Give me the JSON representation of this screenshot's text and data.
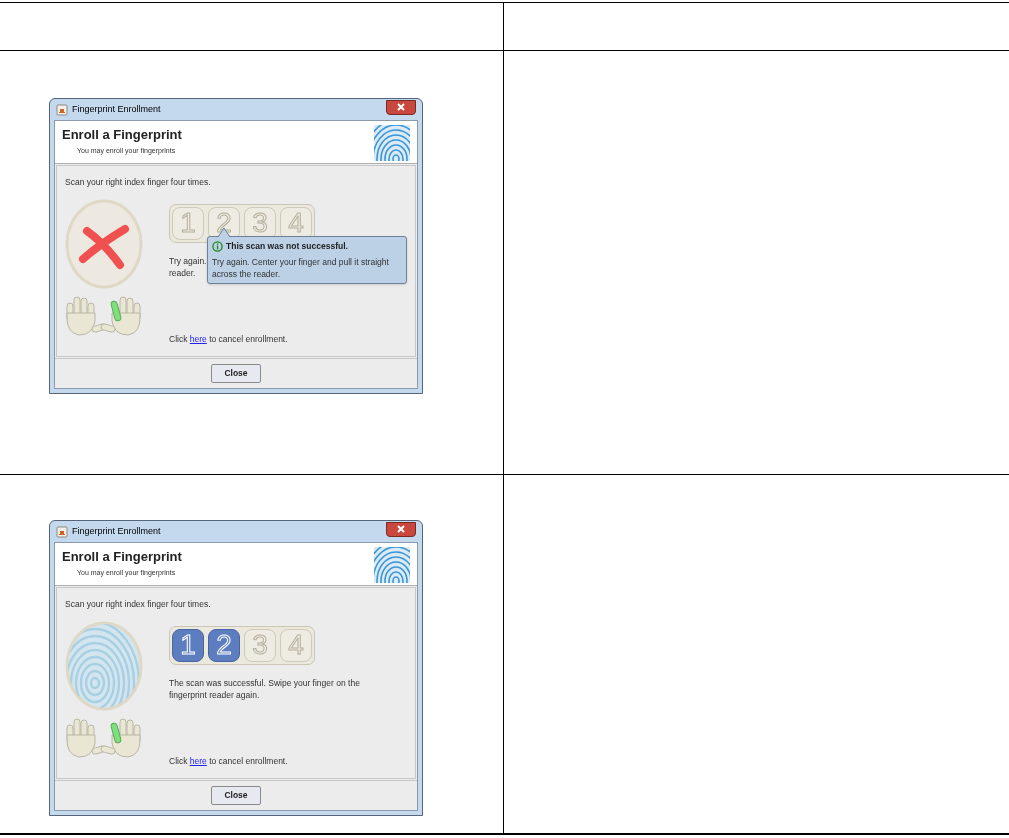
{
  "rows": [
    {
      "window": {
        "title": "Fingerprint Enrollment",
        "heading": "Enroll a Fingerprint",
        "subheading": "You may enroll your fingerprints",
        "instruction": "Scan your right index finger four times.",
        "scan": {
          "kind": "failed"
        },
        "steps": [
          {
            "label": "1",
            "done": false
          },
          {
            "label": "2",
            "done": false
          },
          {
            "label": "3",
            "done": false
          },
          {
            "label": "4",
            "done": false
          }
        ],
        "message_lines": [
          "Try again.",
          "reader."
        ],
        "tooltip": {
          "title": "This scan was not successful.",
          "text": "Try again. Center your finger and pull it straight across the reader."
        },
        "cancel": {
          "before": "Click",
          "link": "here",
          "after": "to cancel enrollment."
        },
        "button": "Close"
      }
    },
    {
      "window": {
        "title": "Fingerprint Enrollment",
        "heading": "Enroll a Fingerprint",
        "subheading": "You may enroll your fingerprints",
        "instruction": "Scan your right index finger four times.",
        "scan": {
          "kind": "success"
        },
        "steps": [
          {
            "label": "1",
            "done": true
          },
          {
            "label": "2",
            "done": true
          },
          {
            "label": "3",
            "done": false
          },
          {
            "label": "4",
            "done": false
          }
        ],
        "message_lines": [
          "The scan was successful. Swipe your finger on the",
          "fingerprint reader again."
        ],
        "cancel": {
          "before": "Click",
          "link": "here",
          "after": "to cancel enrollment."
        },
        "button": "Close"
      }
    }
  ]
}
